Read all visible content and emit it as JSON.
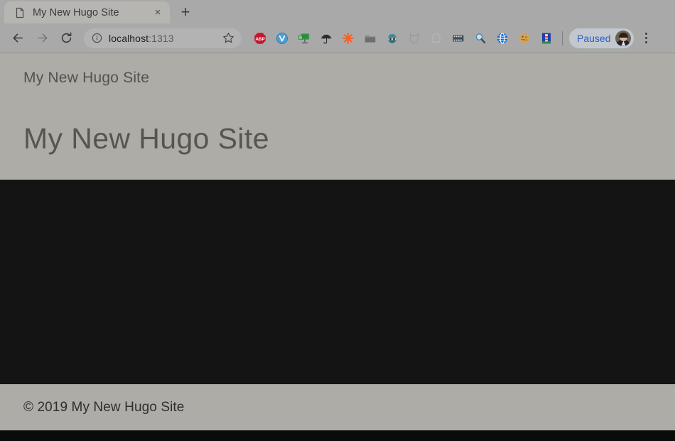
{
  "browser": {
    "tab": {
      "title": "My New Hugo Site",
      "favicon_icon": "page-document-icon",
      "close_label": "×"
    },
    "new_tab_label": "+",
    "nav": {
      "back_icon": "arrow-left-icon",
      "forward_icon": "arrow-right-icon",
      "reload_icon": "reload-icon"
    },
    "omnibox": {
      "security_icon": "info-circle-icon",
      "host": "localhost",
      "port": ":1313",
      "full_url": "localhost:1313",
      "bookmark_icon": "star-outline-icon"
    },
    "extensions": [
      {
        "name": "adblock-plus-extension",
        "glyph": "⛔",
        "label": "ABP"
      },
      {
        "name": "vimium-extension",
        "glyph": "🔵",
        "label": "V"
      },
      {
        "name": "screen-capture-extension",
        "glyph": "🖥",
        "label": ""
      },
      {
        "name": "umbrella-extension",
        "glyph": "☂",
        "label": ""
      },
      {
        "name": "asterisk-extension",
        "glyph": "✳",
        "label": ""
      },
      {
        "name": "folder-extension",
        "glyph": "🗂",
        "label": ""
      },
      {
        "name": "ninja-avatar-extension",
        "glyph": "🥷",
        "label": ""
      },
      {
        "name": "shield-cat-extension",
        "glyph": "🛡",
        "label": ""
      },
      {
        "name": "ghost-extension",
        "glyph": "👻",
        "label": ""
      },
      {
        "name": "film-reel-extension",
        "glyph": "🎞",
        "label": ""
      },
      {
        "name": "magnifier-extension",
        "glyph": "🔎",
        "label": ""
      },
      {
        "name": "globe-extension",
        "glyph": "🌐",
        "label": ""
      },
      {
        "name": "cookie-extension",
        "glyph": "🍪",
        "label": ""
      },
      {
        "name": "lighthouse-extension",
        "glyph": "🗼",
        "label": ""
      }
    ],
    "profile": {
      "status_label": "Paused",
      "avatar_icon": "user-avatar"
    },
    "menu_icon": "three-dot-menu-icon"
  },
  "page": {
    "site_brand": "My New Hugo Site",
    "hero_title": "My New Hugo Site",
    "footer_text": "© 2019 My New Hugo Site"
  },
  "colors": {
    "page_background": "#adaca7",
    "dark_band": "#141414",
    "chrome_background": "#a9a9a9",
    "tab_active": "#b6b5b1",
    "omnibox": "#b3b3b3",
    "profile_chip": "#c3c8cf",
    "profile_text": "#2b5fc4",
    "heading_text": "#56564f",
    "footer_text": "#2e2e2c"
  }
}
